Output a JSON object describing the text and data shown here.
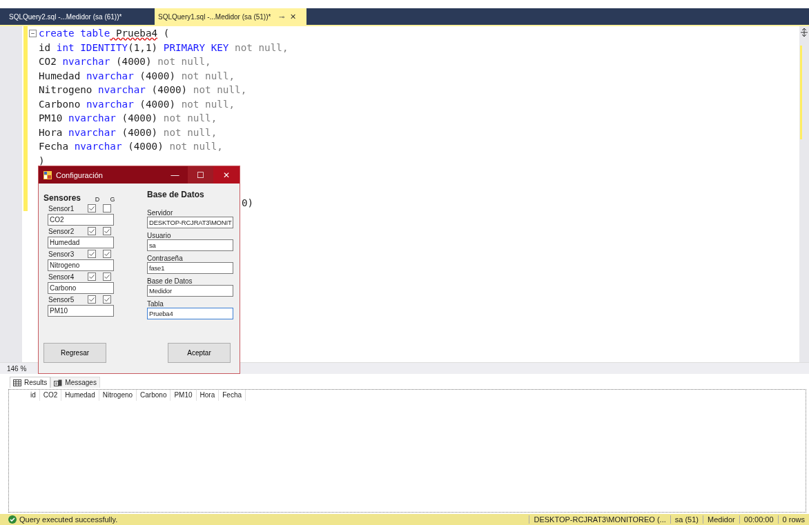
{
  "tabs": [
    {
      "label": "SQLQuery2.sql -...Medidor (sa (61))*",
      "selected": false
    },
    {
      "label": "SQLQuery1.sql -...Medidor (sa (51))*",
      "selected": true,
      "pin": "⊸",
      "close": "✕"
    }
  ],
  "editor": {
    "fold": "−",
    "lines": [
      [
        {
          "text": "create table",
          "kind": "keyword"
        },
        {
          "text": " Prueba4",
          "kind": "error"
        },
        {
          "text": " (",
          "kind": "plain"
        }
      ],
      [
        {
          "text": "id ",
          "kind": "plain"
        },
        {
          "text": "int IDENTITY",
          "kind": "keyword"
        },
        {
          "text": "(1,1) ",
          "kind": "plain"
        },
        {
          "text": "PRIMARY KEY",
          "kind": "keyword"
        },
        {
          "text": " not null,",
          "kind": "muted"
        }
      ],
      [
        {
          "text": "CO2 ",
          "kind": "plain"
        },
        {
          "text": "nvarchar",
          "kind": "keyword"
        },
        {
          "text": " (4000) ",
          "kind": "plain"
        },
        {
          "text": "not null,",
          "kind": "muted"
        }
      ],
      [
        {
          "text": "Humedad ",
          "kind": "plain"
        },
        {
          "text": "nvarchar",
          "kind": "keyword"
        },
        {
          "text": " (4000) ",
          "kind": "plain"
        },
        {
          "text": "not null,",
          "kind": "muted"
        }
      ],
      [
        {
          "text": "Nitrogeno ",
          "kind": "plain"
        },
        {
          "text": "nvarchar",
          "kind": "keyword"
        },
        {
          "text": " (4000) ",
          "kind": "plain"
        },
        {
          "text": "not null,",
          "kind": "muted"
        }
      ],
      [
        {
          "text": "Carbono ",
          "kind": "plain"
        },
        {
          "text": "nvarchar",
          "kind": "keyword"
        },
        {
          "text": " (4000) ",
          "kind": "plain"
        },
        {
          "text": "not null,",
          "kind": "muted"
        }
      ],
      [
        {
          "text": "PM10 ",
          "kind": "plain"
        },
        {
          "text": "nvarchar",
          "kind": "keyword"
        },
        {
          "text": " (4000) ",
          "kind": "plain"
        },
        {
          "text": "not null,",
          "kind": "muted"
        }
      ],
      [
        {
          "text": "Hora ",
          "kind": "plain"
        },
        {
          "text": "nvarchar",
          "kind": "keyword"
        },
        {
          "text": " (4000) ",
          "kind": "plain"
        },
        {
          "text": "not null,",
          "kind": "muted"
        }
      ],
      [
        {
          "text": "Fecha ",
          "kind": "plain"
        },
        {
          "text": "nvarchar",
          "kind": "keyword"
        },
        {
          "text": " (4000) ",
          "kind": "plain"
        },
        {
          "text": "not null,",
          "kind": "muted"
        }
      ],
      [
        {
          "text": ")",
          "kind": "plain"
        }
      ],
      [
        {
          "text": "0)",
          "kind": "plain"
        }
      ]
    ],
    "zoom": "146 %"
  },
  "dialog": {
    "title": "Configuración",
    "minimize": "—",
    "maximize": "☐",
    "close": "✕",
    "sensors_heading": "Sensores",
    "col_d": "D",
    "col_g": "G",
    "sensors": [
      {
        "label": "Sensor1",
        "d": true,
        "g": false,
        "value": "CO2"
      },
      {
        "label": "Sensor2",
        "d": true,
        "g": true,
        "value": "Humedad"
      },
      {
        "label": "Sensor3",
        "d": true,
        "g": true,
        "value": "Nitrogeno"
      },
      {
        "label": "Sensor4",
        "d": true,
        "g": true,
        "value": "Carbono"
      },
      {
        "label": "Sensor5",
        "d": true,
        "g": true,
        "value": "PM10"
      }
    ],
    "db_heading": "Base de Datos",
    "db_fields": [
      {
        "label": "Servidor",
        "value": "DESKTOP-RCJRAT3\\MONIT",
        "focused": false
      },
      {
        "label": "Usuario",
        "value": "sa",
        "focused": false
      },
      {
        "label": "Contraseña",
        "value": "fase1",
        "focused": false
      },
      {
        "label": "Base de Datos",
        "value": "Medidor",
        "focused": false
      },
      {
        "label": "Tabla",
        "value": "Prueba4",
        "focused": true
      }
    ],
    "buttons": [
      "Regresar",
      "Aceptar"
    ]
  },
  "results": {
    "tabs": [
      {
        "label": "Results",
        "selected": true
      },
      {
        "label": "Messages",
        "selected": false
      }
    ],
    "columns": [
      "id",
      "CO2",
      "Humedad",
      "Nitrogeno",
      "Carbono",
      "PM10",
      "Hora",
      "Fecha"
    ]
  },
  "status_bar": {
    "message": "Query executed successfully.",
    "server": "DESKTOP-RCJRAT3\\MONITOREO (...",
    "user": "sa (51)",
    "database": "Medidor",
    "time": "00:00:00",
    "rows": "0 rows"
  }
}
